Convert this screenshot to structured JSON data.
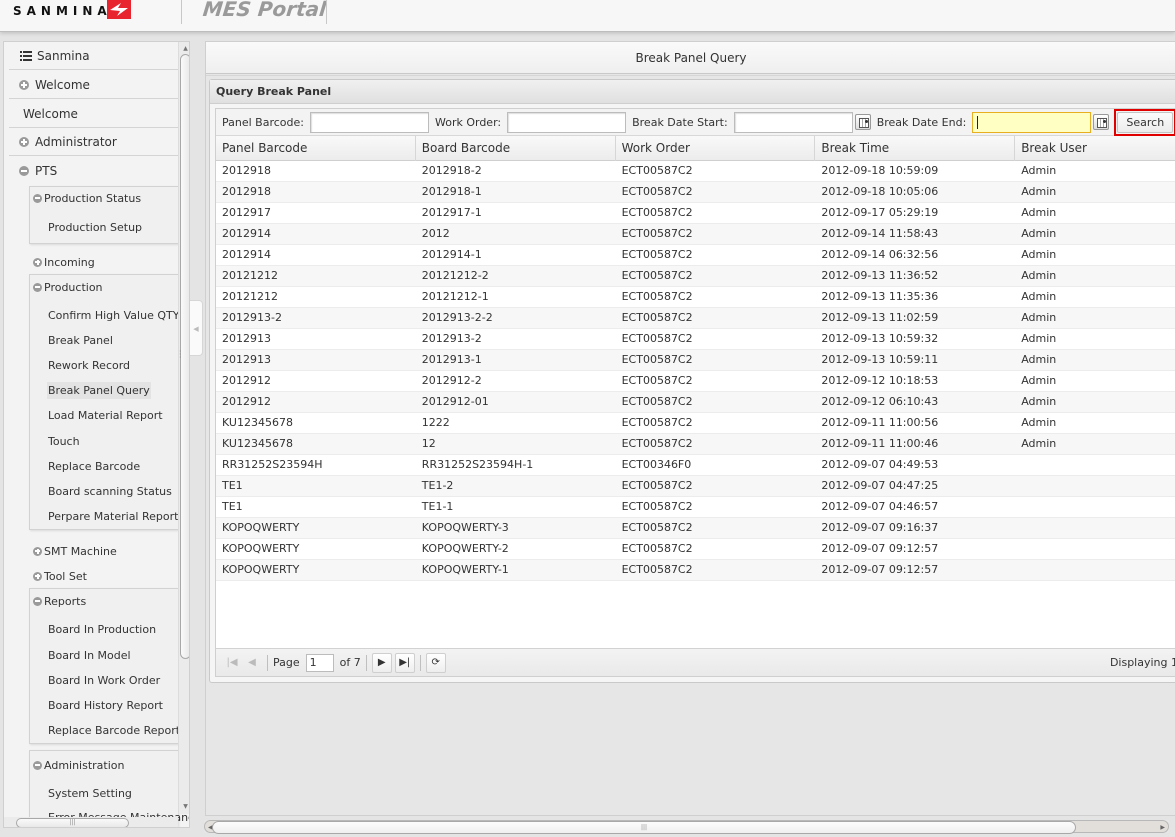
{
  "header": {
    "brand": "SANMINA",
    "portal_title": "MES Portal",
    "brand_color": "#e8242f"
  },
  "sidebar": {
    "root_label": "Sanmina",
    "sections": [
      {
        "label": "Welcome",
        "state": "collapsed"
      },
      {
        "label": "Welcome",
        "state": "item"
      },
      {
        "label": "Administrator",
        "state": "collapsed"
      },
      {
        "label": "PTS",
        "state": "expanded"
      }
    ],
    "pts": {
      "production_status": {
        "label": "Production Status",
        "items": [
          "Production Setup"
        ]
      },
      "incoming": {
        "label": "Incoming"
      },
      "production": {
        "label": "Production",
        "items": [
          "Confirm High Value QTY",
          "Break Panel",
          "Rework Record",
          "Break Panel Query",
          "Load Material Report",
          "Touch",
          "Replace Barcode",
          "Board scanning Status",
          "Perpare Material Report"
        ],
        "active": "Break Panel Query"
      },
      "smt_machine": {
        "label": "SMT Machine"
      },
      "tool_set": {
        "label": "Tool Set"
      },
      "reports": {
        "label": "Reports",
        "items": [
          "Board In Production",
          "Board In Model",
          "Board In Work Order",
          "Board History Report",
          "Replace Barcode Report"
        ]
      },
      "administration": {
        "label": "Administration",
        "items": [
          "System Setting",
          "Error Message Maintenance"
        ]
      }
    }
  },
  "main": {
    "title": "Break Panel Query",
    "panel_title": "Query Break Panel",
    "filters": {
      "panel_barcode": {
        "label": "Panel Barcode:",
        "value": ""
      },
      "work_order": {
        "label": "Work Order:",
        "value": ""
      },
      "break_date_start": {
        "label": "Break Date Start:",
        "value": ""
      },
      "break_date_end": {
        "label": "Break Date End:",
        "value": ""
      },
      "search_label": "Search"
    },
    "grid": {
      "columns": [
        "Panel Barcode",
        "Board Barcode",
        "Work Order",
        "Break Time",
        "Break User"
      ],
      "rows": [
        [
          "2012918",
          "2012918-2",
          "ECT00587C2",
          "2012-09-18 10:59:09",
          "Admin"
        ],
        [
          "2012918",
          "2012918-1",
          "ECT00587C2",
          "2012-09-18 10:05:06",
          "Admin"
        ],
        [
          "2012917",
          "2012917-1",
          "ECT00587C2",
          "2012-09-17 05:29:19",
          "Admin"
        ],
        [
          "2012914",
          "2012",
          "ECT00587C2",
          "2012-09-14 11:58:43",
          "Admin"
        ],
        [
          "2012914",
          "2012914-1",
          "ECT00587C2",
          "2012-09-14 06:32:56",
          "Admin"
        ],
        [
          "20121212",
          "20121212-2",
          "ECT00587C2",
          "2012-09-13 11:36:52",
          "Admin"
        ],
        [
          "20121212",
          "20121212-1",
          "ECT00587C2",
          "2012-09-13 11:35:36",
          "Admin"
        ],
        [
          "2012913-2",
          "2012913-2-2",
          "ECT00587C2",
          "2012-09-13 11:02:59",
          "Admin"
        ],
        [
          "2012913",
          "2012913-2",
          "ECT00587C2",
          "2012-09-13 10:59:32",
          "Admin"
        ],
        [
          "2012913",
          "2012913-1",
          "ECT00587C2",
          "2012-09-13 10:59:11",
          "Admin"
        ],
        [
          "2012912",
          "2012912-2",
          "ECT00587C2",
          "2012-09-12 10:18:53",
          "Admin"
        ],
        [
          "2012912",
          "2012912-01",
          "ECT00587C2",
          "2012-09-12 06:10:43",
          "Admin"
        ],
        [
          "KU12345678",
          "1222",
          "ECT00587C2",
          "2012-09-11 11:00:56",
          "Admin"
        ],
        [
          "KU12345678",
          "12",
          "ECT00587C2",
          "2012-09-11 11:00:46",
          "Admin"
        ],
        [
          "RR31252S23594H",
          "RR31252S23594H-1",
          "ECT00346F0",
          "2012-09-07 04:49:53",
          ""
        ],
        [
          "TE1",
          "TE1-2",
          "ECT00587C2",
          "2012-09-07 04:47:25",
          ""
        ],
        [
          "TE1",
          "TE1-1",
          "ECT00587C2",
          "2012-09-07 04:46:57",
          ""
        ],
        [
          "KOPOQWERTY",
          "KOPOQWERTY-3",
          "ECT00587C2",
          "2012-09-07 09:16:37",
          ""
        ],
        [
          "KOPOQWERTY",
          "KOPOQWERTY-2",
          "ECT00587C2",
          "2012-09-07 09:12:57",
          ""
        ],
        [
          "KOPOQWERTY",
          "KOPOQWERTY-1",
          "ECT00587C2",
          "2012-09-07 09:12:57",
          ""
        ]
      ]
    },
    "pager": {
      "page_label": "Page",
      "page_value": "1",
      "of_label": "of 7",
      "displaying": "Displaying 1"
    }
  }
}
